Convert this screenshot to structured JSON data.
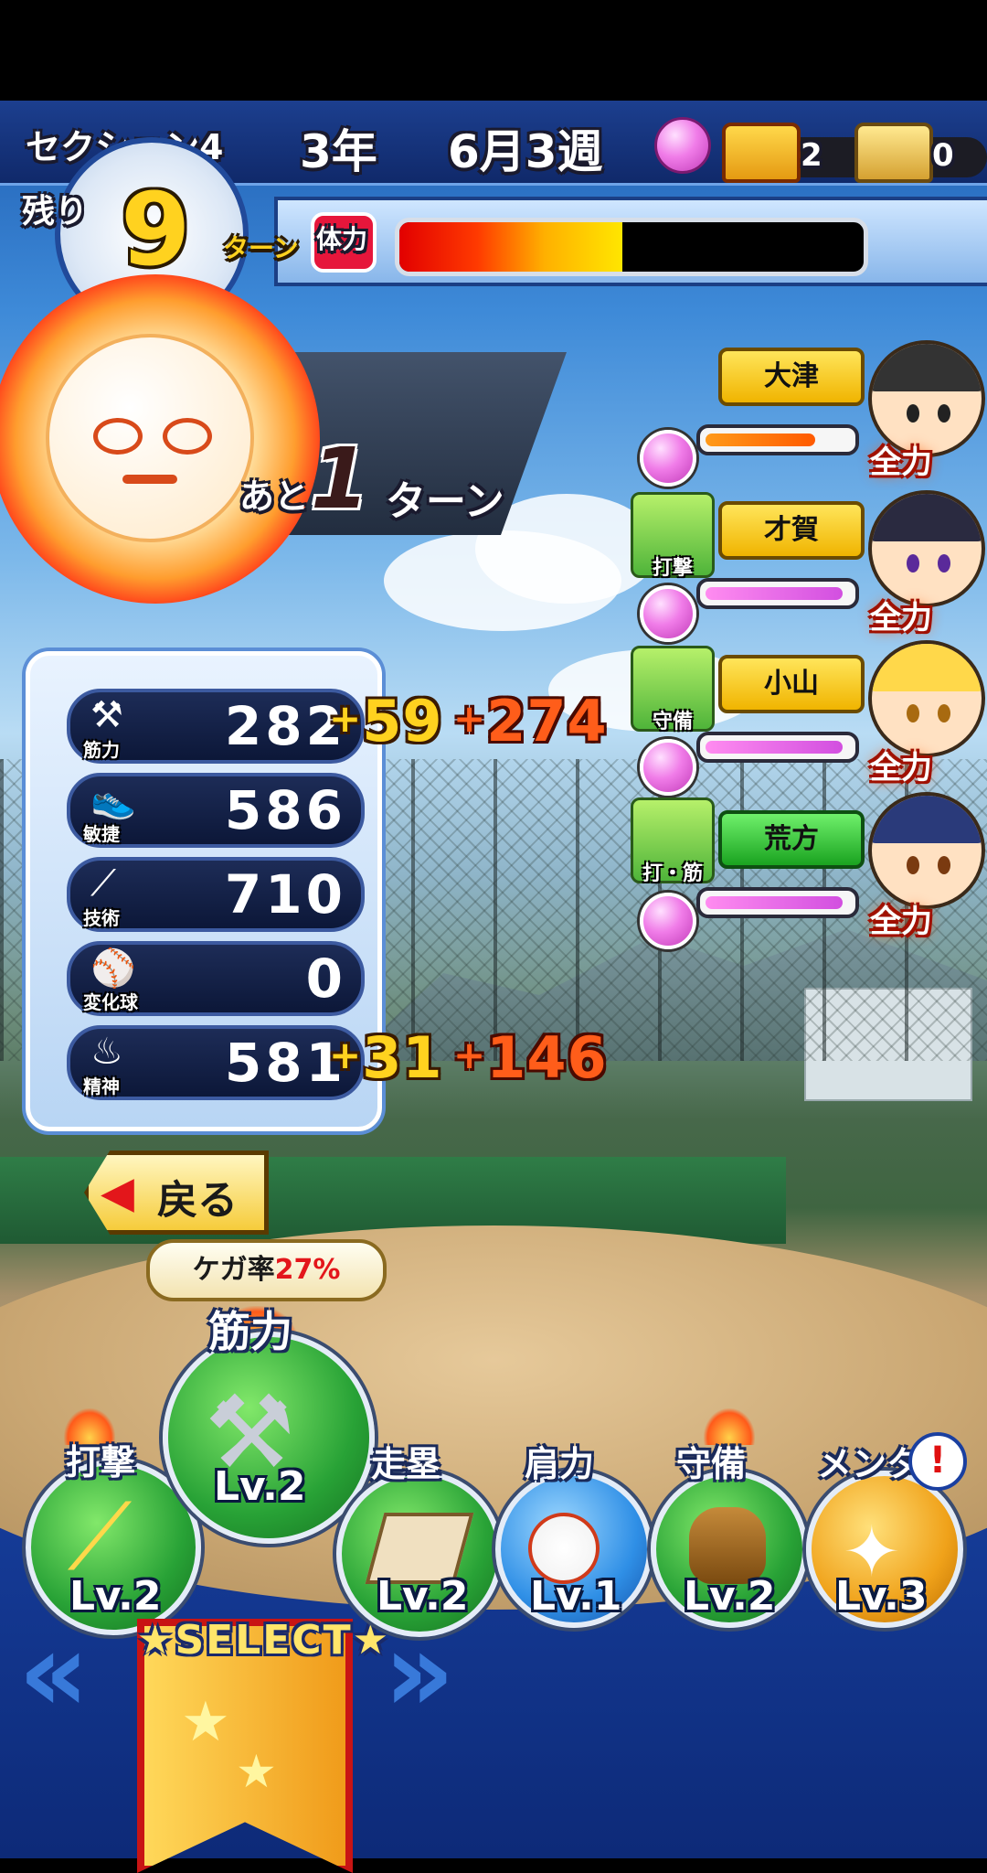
{
  "header": {
    "section": "セクション4",
    "year": "3年",
    "date": "6月3週",
    "chest_count_1": "2",
    "chest_count_2": "0"
  },
  "turns": {
    "remaining_label": "残り",
    "remaining_value": "9",
    "unit": "ターン"
  },
  "stamina": {
    "label": "体力",
    "level_percent": 48
  },
  "event": {
    "prefix": "あと",
    "count": "1",
    "suffix": "ターン"
  },
  "stats": [
    {
      "label": "筋力",
      "value": "282",
      "bonus1": "59",
      "bonus2": "274",
      "icon": "dumbbell-icon"
    },
    {
      "label": "敏捷",
      "value": "586",
      "bonus1": "",
      "bonus2": "",
      "icon": "shoe-icon"
    },
    {
      "label": "技術",
      "value": "710",
      "bonus1": "",
      "bonus2": "",
      "icon": "bat-icon"
    },
    {
      "label": "変化球",
      "value": "0",
      "bonus1": "",
      "bonus2": "",
      "icon": "ball-arrows-icon"
    },
    {
      "label": "精神",
      "value": "581",
      "bonus1": "31",
      "bonus2": "146",
      "icon": "spirit-icon"
    }
  ],
  "characters": [
    {
      "name": "大津",
      "skill": "",
      "plate": "yellow",
      "bond_level": 80,
      "status": "全力"
    },
    {
      "name": "才賀",
      "skill": "打撃",
      "plate": "yellow",
      "bond_level": 100,
      "status": "全力"
    },
    {
      "name": "小山",
      "skill": "守備",
      "plate": "yellow",
      "bond_level": 100,
      "status": "全力"
    },
    {
      "name": "荒方",
      "skill": "打・筋",
      "plate": "green",
      "bond_level": 100,
      "status": "全力"
    }
  ],
  "back_button": "戻る",
  "injury": {
    "prefix": "ケガ率",
    "rate": "27%"
  },
  "training": [
    {
      "label": "打撃",
      "level": "Lv.2",
      "color": "green",
      "icon": "bat-icon"
    },
    {
      "label": "筋力",
      "level": "Lv.2",
      "color": "green",
      "icon": "dumbbell-icon"
    },
    {
      "label": "走塁",
      "level": "Lv.2",
      "color": "green",
      "icon": "base-icon"
    },
    {
      "label": "肩力",
      "level": "Lv.1",
      "color": "blue",
      "icon": "fireball-icon"
    },
    {
      "label": "守備",
      "level": "Lv.2",
      "color": "green",
      "icon": "glove-icon"
    },
    {
      "label": "メンタ",
      "level": "Lv.3",
      "color": "orange",
      "icon": "sparkle-icon"
    }
  ],
  "select_label": "★SELECT★",
  "colors": {
    "accent": "#ffd21f",
    "bonus_red": "#ff5d1a",
    "stamina_fill": "#ffe600"
  }
}
